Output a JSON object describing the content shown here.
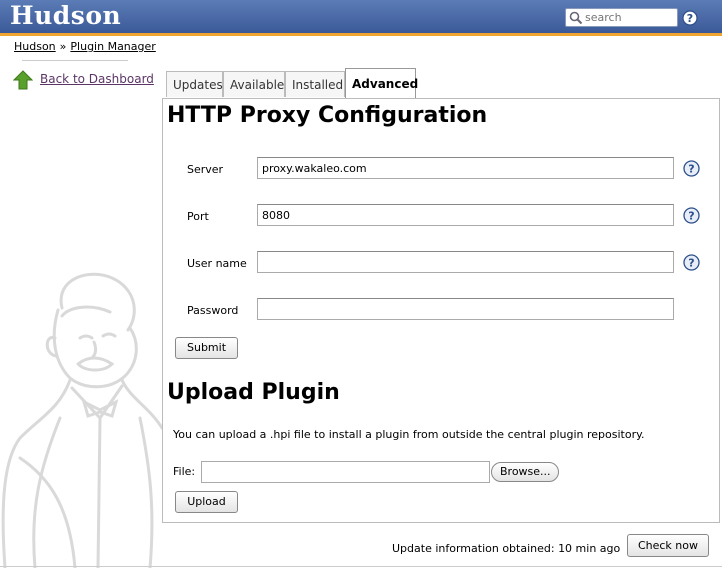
{
  "header": {
    "logo_text": "Hudson",
    "search_placeholder": "search",
    "colors": {
      "bar": "#3b5998",
      "stripe": "#f0a530"
    }
  },
  "breadcrumb": {
    "items": [
      {
        "label": "Hudson"
      },
      {
        "label": "Plugin Manager"
      }
    ],
    "separator": "»"
  },
  "sidebar": {
    "back_label": "Back to Dashboard",
    "back_icon": "up-arrow-icon"
  },
  "tabs": [
    {
      "label": "Updates",
      "active": false
    },
    {
      "label": "Available",
      "active": false
    },
    {
      "label": "Installed",
      "active": false
    },
    {
      "label": "Advanced",
      "active": true
    }
  ],
  "proxy": {
    "title": "HTTP Proxy Configuration",
    "fields": [
      {
        "label": "Server",
        "value": "proxy.wakaleo.com",
        "has_help": true
      },
      {
        "label": "Port",
        "value": "8080",
        "has_help": true
      },
      {
        "label": "User name",
        "value": "",
        "has_help": true
      },
      {
        "label": "Password",
        "value": "",
        "has_help": false
      }
    ],
    "submit_label": "Submit"
  },
  "upload": {
    "title": "Upload Plugin",
    "description": "You can upload a .hpi file to install a plugin from outside the central plugin repository.",
    "file_label": "File:",
    "browse_label": "Browse...",
    "upload_label": "Upload"
  },
  "footer": {
    "update_info": "Update information obtained: 10 min ago",
    "check_now_label": "Check now"
  }
}
